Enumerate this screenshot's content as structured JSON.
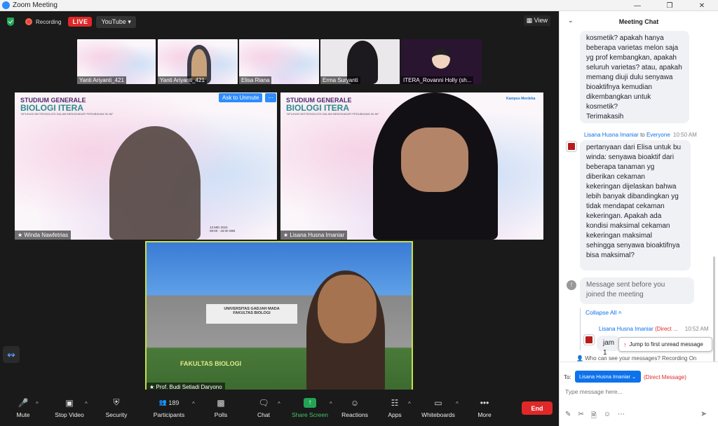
{
  "window": {
    "title": "Zoom Meeting"
  },
  "topbar": {
    "recording": "Recording",
    "live": "LIVE",
    "stream": "YouTube",
    "view": "View"
  },
  "thumbnails": [
    {
      "name": "Yanti Ariyanti_421"
    },
    {
      "name": "Yanti Ariyanti_421"
    },
    {
      "name": "Elisa Riana"
    },
    {
      "name": "Erma Suryanti"
    },
    {
      "name": "ITERA_Rovanni Holly (sh..."
    }
  ],
  "banner": {
    "line1": "STUDIUM GENERALE",
    "line2": "BIOLOGI ITERA",
    "line3": "\"APLIKASI BIOTEKNOLOGI DALAM MENGHADAPI PERUBAHAN IKLIM\""
  },
  "tiles": {
    "main_left": {
      "name": "Winda Nawfetrias",
      "date": "13 MEI 2023",
      "time": "09:00 - 16:00 WIB"
    },
    "main_right": {
      "name": "Lisana Husna Imaniar",
      "logo_text": "Kampus Merdeka"
    },
    "active": {
      "name": "Prof. Budi Setiadi Daryono",
      "sign1": "UNIVERSITAS GADJAH MADA",
      "sign2": "FAKULTAS BIOLOGI",
      "sign3": "FAKULTAS BIOLOGI"
    }
  },
  "ask_to_unmute": "Ask to Unmute",
  "toolbar": {
    "mute": "Mute",
    "stop_video": "Stop Video",
    "security": "Security",
    "participants": "Participants",
    "participants_count": "189",
    "polls": "Polls",
    "chat": "Chat",
    "share_screen": "Share Screen",
    "reactions": "Reactions",
    "apps": "Apps",
    "whiteboards": "Whiteboards",
    "more": "More",
    "end": "End"
  },
  "chat": {
    "title": "Meeting Chat",
    "msg1_lines": [
      "kosmetik? apakah hanya",
      "beberapa varietas melon saja",
      "yg prof kembangkan, apakah",
      "seluruh varietas? atau, apakah",
      "memang diuji dulu senyawa",
      "bioaktifnya kemudian",
      "dikembangkan untuk",
      "kosmetik?",
      "Terimakasih"
    ],
    "sender2": "Lisana Husna Imaniar",
    "to2": "to",
    "everyone2": "Everyone",
    "time2": "10:50 AM",
    "msg2_lines": [
      "pertanyaan dari Elisa untuk bu",
      "winda: senyawa bioaktif dari",
      "beberapa tanaman yg",
      "diberikan cekaman",
      "kekeringan dijelaskan bahwa",
      "lebih banyak dibandingkan yg",
      "tidak mendapat cekaman",
      "kekeringan. Apakah ada",
      "kondisi maksimal cekaman",
      "kekeringan maksimal",
      "sehingga senyawa bioaktifnya",
      "bisa maksimal?"
    ],
    "system_lines": [
      "Message sent before you",
      "joined the meeting"
    ],
    "collapse": "Collapse All",
    "sender3": "Lisana Husna Imaniar",
    "direct3": "(Direct ...",
    "time3": "10:52 AM",
    "msg3": "jam 1",
    "jump": "Jump to first unread message",
    "privacy": "Who can see your messages? Recording On",
    "to_label": "To:",
    "recipient": "Lisana Husna Imaniar",
    "direct_label": "(Direct Message)",
    "placeholder": "Type message here..."
  }
}
